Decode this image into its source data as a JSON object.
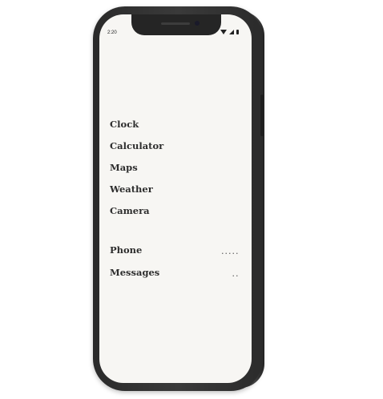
{
  "status_bar": {
    "time": "2:20",
    "icons": [
      "wifi-icon",
      "signal-icon",
      "battery-icon"
    ]
  },
  "apps": [
    {
      "label": "Clock"
    },
    {
      "label": "Calculator"
    },
    {
      "label": "Maps"
    },
    {
      "label": "Weather"
    },
    {
      "label": "Camera"
    }
  ],
  "dock": [
    {
      "label": "Phone",
      "notification_dots": "....."
    },
    {
      "label": "Messages",
      "notification_dots": ".."
    }
  ],
  "colors": {
    "screen_background": "#f7f6f3",
    "text": "#2d2d2d",
    "phone_frame": "#2f2f2f"
  }
}
